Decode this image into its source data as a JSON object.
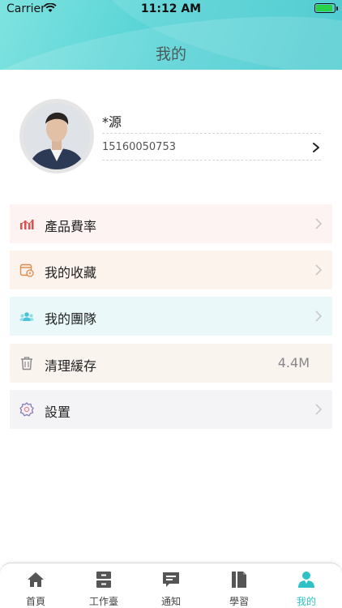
{
  "status_bar": {
    "carrier": "Carrier",
    "time": "11:12 AM"
  },
  "header": {
    "title": "我的"
  },
  "profile": {
    "name": "*源",
    "phone": "15160050753"
  },
  "menu": [
    {
      "label": "產品費率",
      "icon": "bar-chart-icon",
      "bg": "#fdf3f3",
      "accent": "#e0504e"
    },
    {
      "label": "我的收藏",
      "icon": "wallet-icon",
      "bg": "#fcf3ec",
      "accent": "#e08a4a"
    },
    {
      "label": "我的團隊",
      "icon": "team-icon",
      "bg": "#eaf8f9",
      "accent": "#4ac4d6"
    },
    {
      "label": "清理緩存",
      "icon": "trash-icon",
      "bg": "#faf4ee",
      "accent": "#888888",
      "value": "4.4M"
    },
    {
      "label": "設置",
      "icon": "settings-icon",
      "bg": "#f4f4f6",
      "accent": "#8a7ab8"
    }
  ],
  "tabs": [
    {
      "label": "首頁",
      "icon": "home-icon"
    },
    {
      "label": "工作臺",
      "icon": "cabinet-icon"
    },
    {
      "label": "通知",
      "icon": "message-icon"
    },
    {
      "label": "學習",
      "icon": "book-icon"
    },
    {
      "label": "我的",
      "icon": "user-icon",
      "active": true
    }
  ],
  "colors": {
    "accent": "#2ec2c6",
    "header_start": "#7fe3e0",
    "header_end": "#3cc6cc"
  }
}
